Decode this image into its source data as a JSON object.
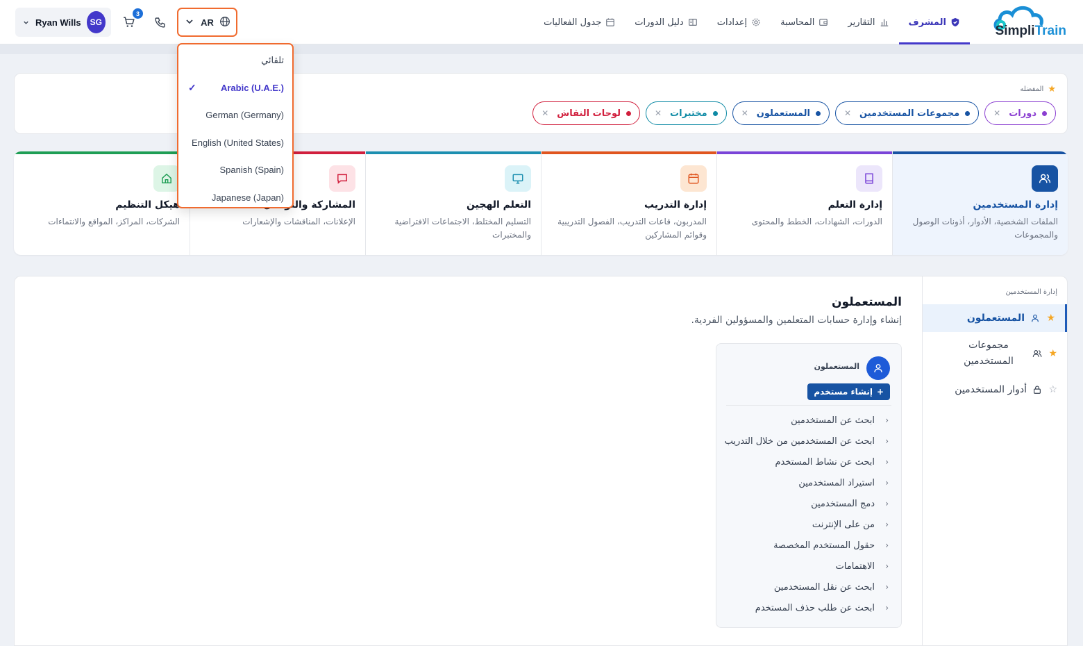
{
  "brand": {
    "logo_text_1": "Simpli",
    "logo_text_2": "Train",
    "accent": "#1a8fd6"
  },
  "nav": {
    "items": [
      {
        "label": "المشرف",
        "icon": "shield-icon",
        "active": true
      },
      {
        "label": "التقارير",
        "icon": "bar-chart-icon"
      },
      {
        "label": "المحاسبة",
        "icon": "wallet-icon"
      },
      {
        "label": "إعدادات",
        "icon": "gear-icon"
      },
      {
        "label": "دليل الدورات",
        "icon": "book-open-icon"
      },
      {
        "label": "جدول الفعاليات",
        "icon": "calendar-icon"
      }
    ]
  },
  "language": {
    "current": "AR",
    "options": [
      {
        "label": "تلقائي"
      },
      {
        "label": "Arabic (U.A.E.)",
        "selected": true
      },
      {
        "label": "German (Germany)"
      },
      {
        "label": "English (United States)"
      },
      {
        "label": "Spanish (Spain)"
      },
      {
        "label": "Japanese (Japan)"
      }
    ],
    "check": "✓"
  },
  "cart": {
    "count": "3"
  },
  "user": {
    "initials": "SG",
    "name": "Ryan Wills"
  },
  "favorites": {
    "title": "المفضله",
    "chips": [
      {
        "label": "دورات",
        "color": "#8b3fd1"
      },
      {
        "label": "مجموعات المستخدمين",
        "color": "#1753a3"
      },
      {
        "label": "المستعملون",
        "color": "#1753a3"
      },
      {
        "label": "مختبرات",
        "color": "#0e8aa5"
      },
      {
        "label": "لوحات النقاش",
        "color": "#d11f3d"
      }
    ]
  },
  "categories": [
    {
      "title": "إدارة المستخدمين",
      "desc": "الملفات الشخصية، الأدوار، أذونات الوصول والمجموعات",
      "color": "#1753a3",
      "icon_bg": "#1753a3",
      "icon": "users-icon",
      "active": true
    },
    {
      "title": "إدارة التعلم",
      "desc": "الدورات، الشهادات، الخطط والمحتوى",
      "color": "#7a44d8",
      "icon_bg": "#ece6fb",
      "icon": "book-icon"
    },
    {
      "title": "إدارة التدريب",
      "desc": "المدربون، قاعات التدريب، الفصول التدريبية وقوائم المشاركين",
      "color": "#e0551f",
      "icon_bg": "#fde6d2",
      "icon": "calendar-icon"
    },
    {
      "title": "التعلم الهجين",
      "desc": "التسليم المختلط، الاجتماعات الافتراضية والمختبرات",
      "color": "#1c8fb0",
      "icon_bg": "#dbf3f8",
      "icon": "monitor-icon"
    },
    {
      "title": "المشاركة والتواصل",
      "desc": "الإعلانات، المناقشات والإشعارات",
      "color": "#d11f3d",
      "icon_bg": "#fde2e6",
      "icon": "chat-icon"
    },
    {
      "title": "هيكل التنظيم",
      "desc": "الشركات، المراكز، المواقع والانتماءات",
      "color": "#1f9e55",
      "icon_bg": "#ddf5e6",
      "icon": "home-icon"
    }
  ],
  "sidebar": {
    "header": "إدارة المستخدمين",
    "items": [
      {
        "label": "المستعملون",
        "starred": true,
        "icon": "user-icon",
        "active": true
      },
      {
        "label": "مجموعات المستخدمين",
        "starred": true,
        "icon": "users-icon"
      },
      {
        "label": "أدوار المستخدمين",
        "starred": false,
        "icon": "lock-icon"
      }
    ]
  },
  "main": {
    "title": "المستعملون",
    "subtitle": "إنشاء وإدارة حسابات المتعلمين والمسؤولين الفردية.",
    "panel": {
      "label": "المستعملون",
      "create_button": "إنشاء مستخدم",
      "links": [
        "ابحث عن المستخدمين",
        "ابحث عن المستخدمين من خلال التدريب",
        "ابحث عن نشاط المستخدم",
        "استيراد المستخدمين",
        "دمج المستخدمين",
        "من على الإنترنت",
        "حقول المستخدم المخصصة",
        "الاهتمامات",
        "ابحث عن نقل المستخدمين",
        "ابحث عن طلب حذف المستخدم"
      ]
    }
  }
}
